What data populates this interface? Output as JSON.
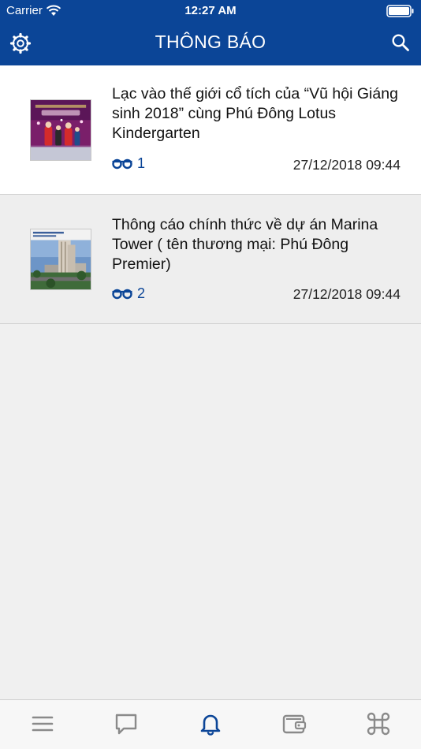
{
  "status_bar": {
    "carrier": "Carrier",
    "time": "12:27 AM"
  },
  "header": {
    "title": "THÔNG BÁO"
  },
  "notifications": [
    {
      "title": "Lạc vào thế giới cổ tích của “Vũ hội Giáng sinh 2018” cùng Phú Đông Lotus Kindergarten",
      "views": "1",
      "date": "27/12/2018 09:44"
    },
    {
      "title": "Thông cáo chính thức về dự án Marina Tower ( tên thương mại: Phú Đông Premier)",
      "views": "2",
      "date": "27/12/2018 09:44"
    }
  ],
  "tabbar": {
    "tabs": [
      {
        "icon": "menu-icon"
      },
      {
        "icon": "chat-icon"
      },
      {
        "icon": "bell-icon",
        "active": true
      },
      {
        "icon": "wallet-icon"
      },
      {
        "icon": "command-icon"
      }
    ]
  },
  "colors": {
    "primary": "#0b4597",
    "inactive_tab": "#8a8a8a"
  }
}
